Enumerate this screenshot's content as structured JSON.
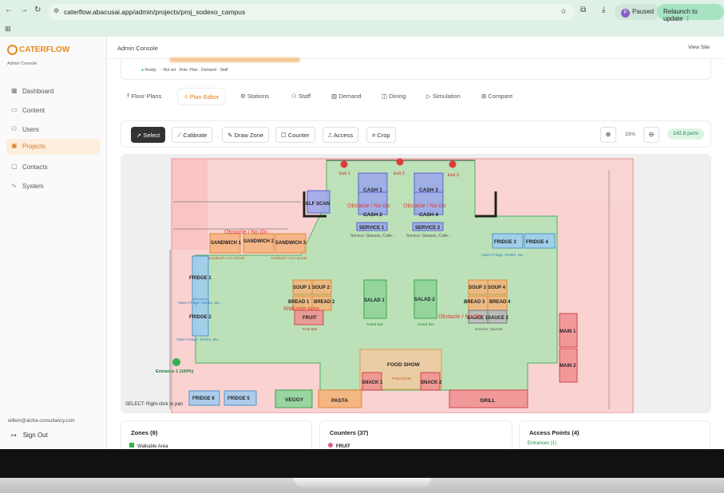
{
  "browser": {
    "url": "caterflow.abacusai.app/admin/projects/proj_sodexo_campus",
    "paused_label": "Paused",
    "relaunch_label": "Relaunch to update",
    "avatar_initial": "P"
  },
  "sidebar": {
    "brand": "CATERFLOW",
    "subtitle": "Admin Console",
    "items": [
      {
        "label": "Dashboard",
        "icon": "grid-icon"
      },
      {
        "label": "Content",
        "icon": "document-icon"
      },
      {
        "label": "Users",
        "icon": "users-icon"
      },
      {
        "label": "Projects",
        "icon": "folder-icon",
        "active": true
      },
      {
        "label": "Contacts",
        "icon": "chat-icon"
      },
      {
        "label": "System",
        "icon": "pulse-icon"
      }
    ],
    "user_email": "willem@aloha-consultancy.com",
    "signout_label": "Sign Out"
  },
  "header": {
    "title": "Admin Console",
    "view_site": "View Site"
  },
  "status": {
    "ready": "Ready",
    "not_set": "Not set",
    "dots": "Dots: Plan · Demand · Staff"
  },
  "tabs": [
    {
      "label": "Floor Plans",
      "icon": "upload-icon"
    },
    {
      "label": "Plan Editor",
      "icon": "pin-icon",
      "active": true
    },
    {
      "label": "Stations",
      "icon": "gear-icon"
    },
    {
      "label": "Staff",
      "icon": "users-icon"
    },
    {
      "label": "Demand",
      "icon": "bar-chart-icon"
    },
    {
      "label": "Dining",
      "icon": "dining-icon"
    },
    {
      "label": "Simulation",
      "icon": "play-icon"
    },
    {
      "label": "Compare",
      "icon": "compare-icon"
    }
  ],
  "toolbar": {
    "tools": [
      {
        "label": "Select",
        "icon": "cursor-icon",
        "selected": true
      },
      {
        "label": "Calibrate",
        "icon": "ruler-icon"
      },
      {
        "label": "Draw Zone",
        "icon": "pen-icon"
      },
      {
        "label": "Counter",
        "icon": "square-icon"
      },
      {
        "label": "Access",
        "icon": "door-icon"
      },
      {
        "label": "Crop",
        "icon": "crop-icon"
      }
    ],
    "zoom": "33%",
    "scale": "142.8 px/m"
  },
  "canvas": {
    "hint": "SELECT: Right-click to pan",
    "labels": {
      "exit1": "Exit 1",
      "exit2": "Exit 2",
      "exit3": "Exit 3",
      "cash1": "CASH 1",
      "cash2": "CASH 2",
      "cash3": "CASH 3",
      "cash4": "CASH 4",
      "service1": "SERVICE 1",
      "service2": "SERVICE 2",
      "service_sub": "Service: Glasses, Cutle...",
      "self_scan": "SELF SCAN",
      "obstacle": "Obstacle / No Go",
      "sandwich1": "SANDWICH 1",
      "sandwich2": "SANDWICH 2",
      "sandwich3": "SANDWICH 3",
      "sandwich_sub": "Sandwich a la minute",
      "fridge1": "FRIDGE 1",
      "fridge2": "FRIDGE 2",
      "fridge3": "FRIDGE 3",
      "fridge4": "FRIDGE 4",
      "fridge5": "FRIDGE 5",
      "fridge6": "FRIDGE 6",
      "open_fridge": "Open Fridge: Drinks, De...",
      "soup1": "SOUP 1",
      "soup2": "SOUP 2",
      "soup3": "SOUP 3",
      "soup4": "SOUP 4",
      "bread1": "BREAD 1",
      "bread2": "BREAD 2",
      "bread3": "BREAD 3",
      "bread4": "BREAD 4",
      "fruit": "FRUIT",
      "fruit_bar": "Fruit Bar",
      "salad1": "SALAD 1",
      "salad2": "SALAD 2",
      "salad_bar": "Salad Bar",
      "sauce1": "SAUCE 1",
      "sauce2": "SAUCE 2",
      "sauces": "Service: Sauces",
      "walkable": "Walkable Area",
      "main1": "MAIN 1",
      "main2": "MAIN 2",
      "food_show": "FOOD SHOW",
      "food_show_sub": "Food Show",
      "snack1": "SNACK 1",
      "snack2": "SNACK 2",
      "veggy": "VEGGY",
      "pasta": "PASTA",
      "grill": "GRILL",
      "entrance": "Entrance 1 (100%)"
    }
  },
  "panels": {
    "zones": {
      "title": "Zones (9)",
      "first": "Walkable Area"
    },
    "counters": {
      "title": "Counters (37)",
      "first": "FRUIT"
    },
    "access": {
      "title": "Access Points (4)",
      "entrances": "Entrances (1)"
    }
  },
  "colors": {
    "accent": "#e07b20",
    "walkable": "#9fe3a8",
    "obstacle": "#f7b5b5",
    "counter_blue": "#7a8fe0",
    "counter_orange": "#e89c4c",
    "counter_green": "#5fbf6f",
    "counter_red": "#e06a6a",
    "fridge": "#7fb6e0"
  }
}
